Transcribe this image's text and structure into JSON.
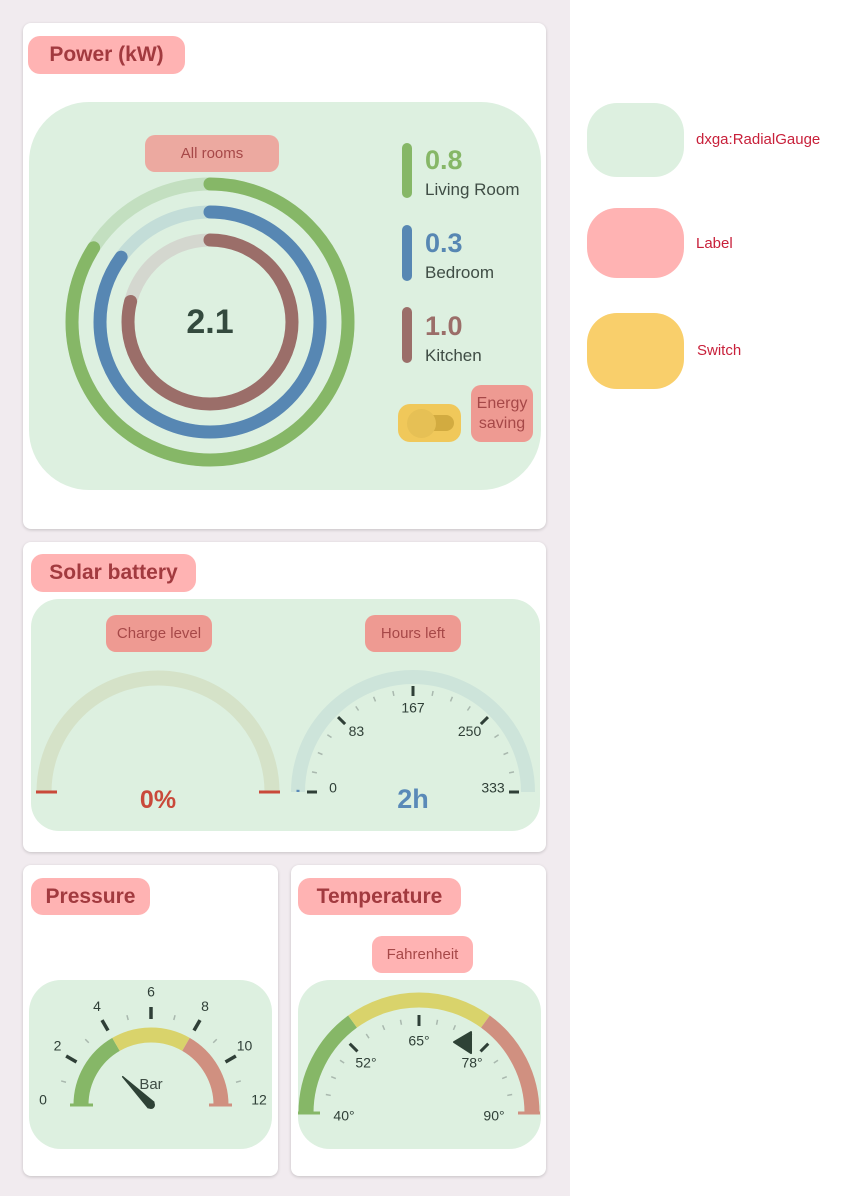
{
  "power": {
    "title": "Power (kW)",
    "sublabel": "All rooms",
    "total": "2.1",
    "rooms": [
      {
        "value": "0.8",
        "name": "Living Room",
        "color": "#86b767",
        "track": "#c3dfc0",
        "fraction": 0.84
      },
      {
        "value": "0.3",
        "name": "Bedroom",
        "color": "#5787b3",
        "track": "#c3ddd8",
        "fraction": 0.85
      },
      {
        "value": "1.0",
        "name": "Kitchen",
        "color": "#9b6e69",
        "track": "#d4d7cf",
        "fraction": 0.79
      }
    ],
    "toggle": {
      "label": "Energy saving",
      "state": "off",
      "color": "#f0c85a"
    }
  },
  "solar": {
    "title": "Solar battery",
    "charge": {
      "label": "Charge level",
      "value_text": "0%",
      "value": 0,
      "color": "#c9493a"
    },
    "hours": {
      "label": "Hours left",
      "value_text": "2h",
      "value": 2,
      "min": 0,
      "max": 333,
      "color": "#5a8ab8",
      "ticks": [
        {
          "v": 0,
          "t": "0"
        },
        {
          "v": 83.25,
          "t": "83"
        },
        {
          "v": 166.5,
          "t": "167"
        },
        {
          "v": 249.75,
          "t": "250"
        },
        {
          "v": 333,
          "t": "333"
        }
      ]
    }
  },
  "pressure": {
    "title": "Pressure",
    "unit": "Bar",
    "min": 0,
    "max": 12,
    "value": 3,
    "ranges": [
      {
        "from": 0,
        "to": 4,
        "color": "#86b767"
      },
      {
        "from": 4,
        "to": 8,
        "color": "#d9d36b"
      },
      {
        "from": 8,
        "to": 12,
        "color": "#d09080"
      }
    ],
    "ticks": [
      {
        "v": 0,
        "t": "0"
      },
      {
        "v": 2,
        "t": "2"
      },
      {
        "v": 4,
        "t": "4"
      },
      {
        "v": 6,
        "t": "6"
      },
      {
        "v": 8,
        "t": "8"
      },
      {
        "v": 10,
        "t": "10"
      },
      {
        "v": 12,
        "t": "12"
      }
    ]
  },
  "temperature": {
    "title": "Temperature",
    "sublabel": "Fahrenheit",
    "min": 40,
    "max": 90,
    "value": 74,
    "ranges": [
      {
        "from": 40,
        "to": 55,
        "color": "#86b767"
      },
      {
        "from": 55,
        "to": 75,
        "color": "#d9d36b"
      },
      {
        "from": 75,
        "to": 90,
        "color": "#d09080"
      }
    ],
    "ticks": [
      {
        "v": 40,
        "t": "40°"
      },
      {
        "v": 52.5,
        "t": "52°"
      },
      {
        "v": 65,
        "t": "65°"
      },
      {
        "v": 77.5,
        "t": "78°"
      },
      {
        "v": 90,
        "t": "90°"
      }
    ]
  },
  "legend": [
    {
      "label": "dxga:RadialGauge",
      "color": "#ddf0e0"
    },
    {
      "label": "Label",
      "color": "#ffb3b3"
    },
    {
      "label": "Switch",
      "color": "#f9cf6b"
    }
  ]
}
